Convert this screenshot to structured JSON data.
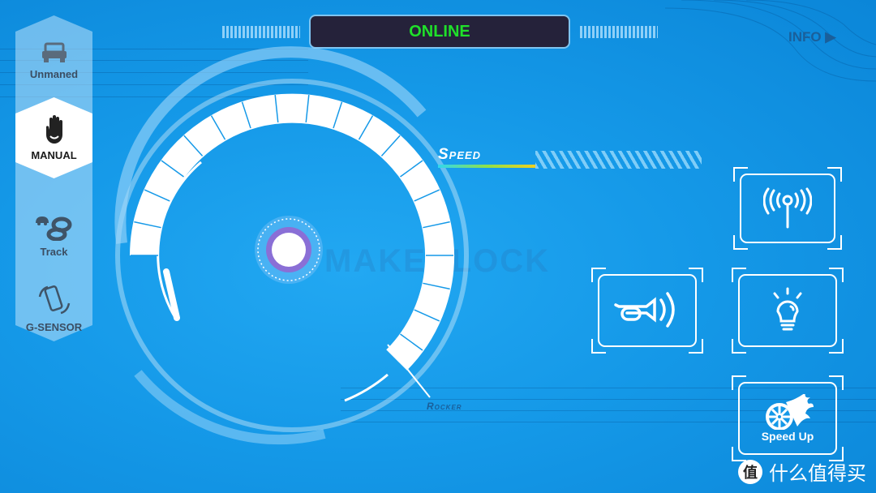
{
  "modes": [
    {
      "label": "Unmaned",
      "icon": "car-icon",
      "active": false
    },
    {
      "label": "MANUAL",
      "icon": "hand-icon",
      "active": true
    },
    {
      "label": "Track",
      "icon": "track-figure-eight-icon",
      "active": false
    },
    {
      "label": "G-SENSOR",
      "icon": "phone-rotate-icon",
      "active": false
    }
  ],
  "status": {
    "label": "ONLINE",
    "color": "#1fe02a"
  },
  "info": {
    "label": "INFO"
  },
  "gauge": {
    "speed_label": "Speed",
    "rocker_label": "Rocker"
  },
  "buttons": {
    "signal": {
      "icon": "antenna-signal-icon"
    },
    "horn": {
      "icon": "horn-icon"
    },
    "light": {
      "icon": "light-bulb-icon"
    },
    "speed_up": {
      "label": "Speed Up",
      "icon": "wheel-flame-icon"
    }
  },
  "watermarks": {
    "center": "MAKEBLOCK",
    "corner_badge": "值",
    "corner_text": "什么值得买"
  },
  "colors": {
    "background": "#1599e8",
    "sidebar_active": "#ffffff",
    "status_bg": "#25223a"
  }
}
